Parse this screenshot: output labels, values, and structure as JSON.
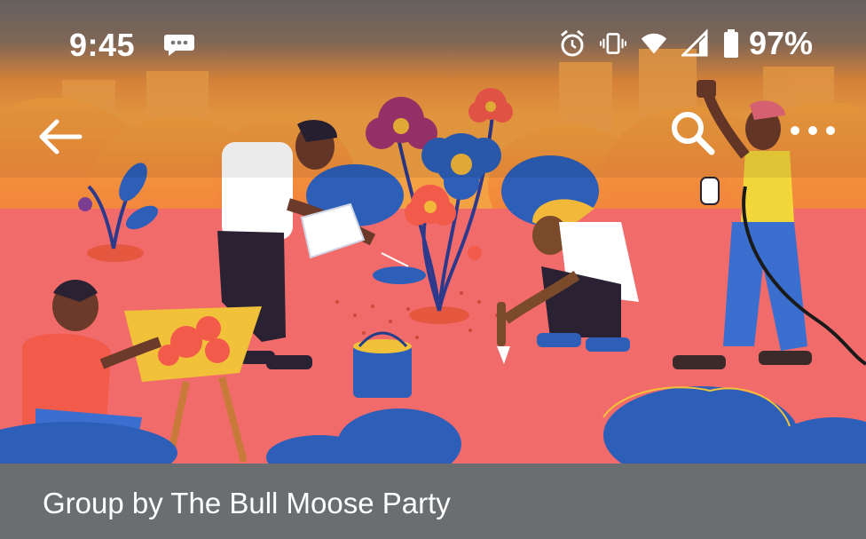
{
  "status_bar": {
    "time": "9:45",
    "battery": "97%",
    "icons": [
      "chat-bubble-icon",
      "alarm-icon",
      "vibrate-icon",
      "wifi-icon",
      "signal-icon",
      "battery-icon"
    ]
  },
  "app_bar": {
    "icons": [
      "back-arrow-icon",
      "search-icon",
      "more-options-icon"
    ]
  },
  "cover_image": {
    "description": "illustration-community-gardening"
  },
  "group_info": {
    "group_by": "Group by The Bull Moose Party"
  },
  "colors": {
    "hero_pink": "#f26b6b",
    "hero_orange": "#f3903a",
    "footer_gray": "#6b6e70",
    "flower_blue": "#2d5fb8",
    "white": "#ffffff"
  }
}
